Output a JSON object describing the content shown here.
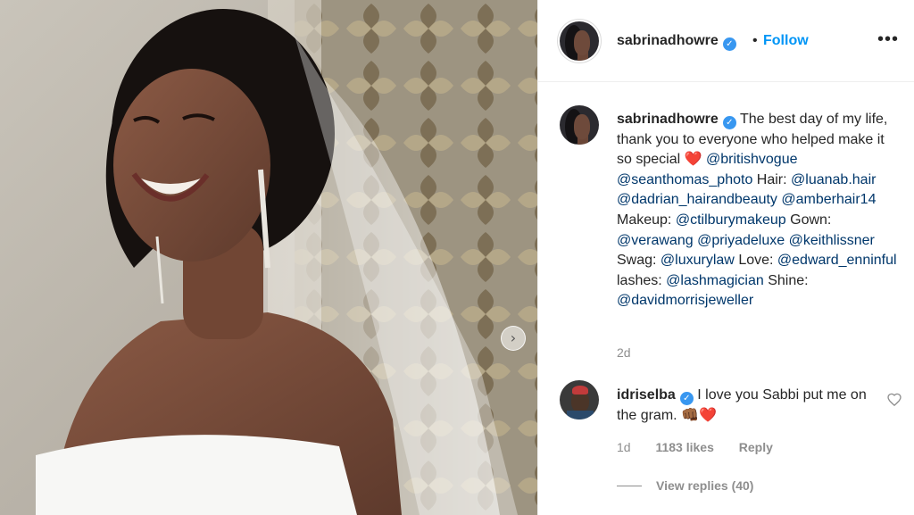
{
  "post": {
    "username": "sabrinadhowre",
    "separator": "•",
    "follow_label": "Follow",
    "more_label": "•••",
    "next_label": "›",
    "caption": {
      "username": "sabrinadhowre",
      "text_1": "The best day of my life, thank you to everyone who helped make it so special",
      "heart": "❤️",
      "mention_1": "@britishvogue",
      "mention_2": "@seanthomas_photo",
      "text_hair": "Hair:",
      "mention_3": "@luanab.hair",
      "mention_4": "@dadrian_hairandbeauty",
      "mention_5": "@amberhair14",
      "text_makeup": "Makeup:",
      "mention_6": "@ctilburymakeup",
      "text_gown": "Gown:",
      "mention_7": "@verawang",
      "mention_8": "@priyadeluxe",
      "mention_9": "@keithlissner",
      "text_swag": "Swag:",
      "mention_10": "@luxurylaw",
      "text_love": "Love:",
      "mention_11": "@edward_enninful",
      "text_lashes": "lashes:",
      "mention_12": "@lashmagician",
      "text_shine": "Shine:",
      "mention_13": "@davidmorrisjeweller"
    },
    "age": "2d"
  },
  "comment": {
    "username": "idriselba",
    "text": "I love you Sabbi put me on the gram.",
    "emoji": "👊🏾❤️",
    "age": "1d",
    "likes": "1183 likes",
    "reply_label": "Reply",
    "view_replies": "View replies (40)"
  },
  "colors": {
    "link": "#00376b",
    "follow": "#0095f6",
    "verified": "#3897f0",
    "muted": "#8e8e8e",
    "heart": "#ed4956"
  },
  "icons": {
    "verified": "verified-badge-icon",
    "like": "heart-outline-icon",
    "next": "chevron-right-icon",
    "more": "more-options-icon"
  }
}
